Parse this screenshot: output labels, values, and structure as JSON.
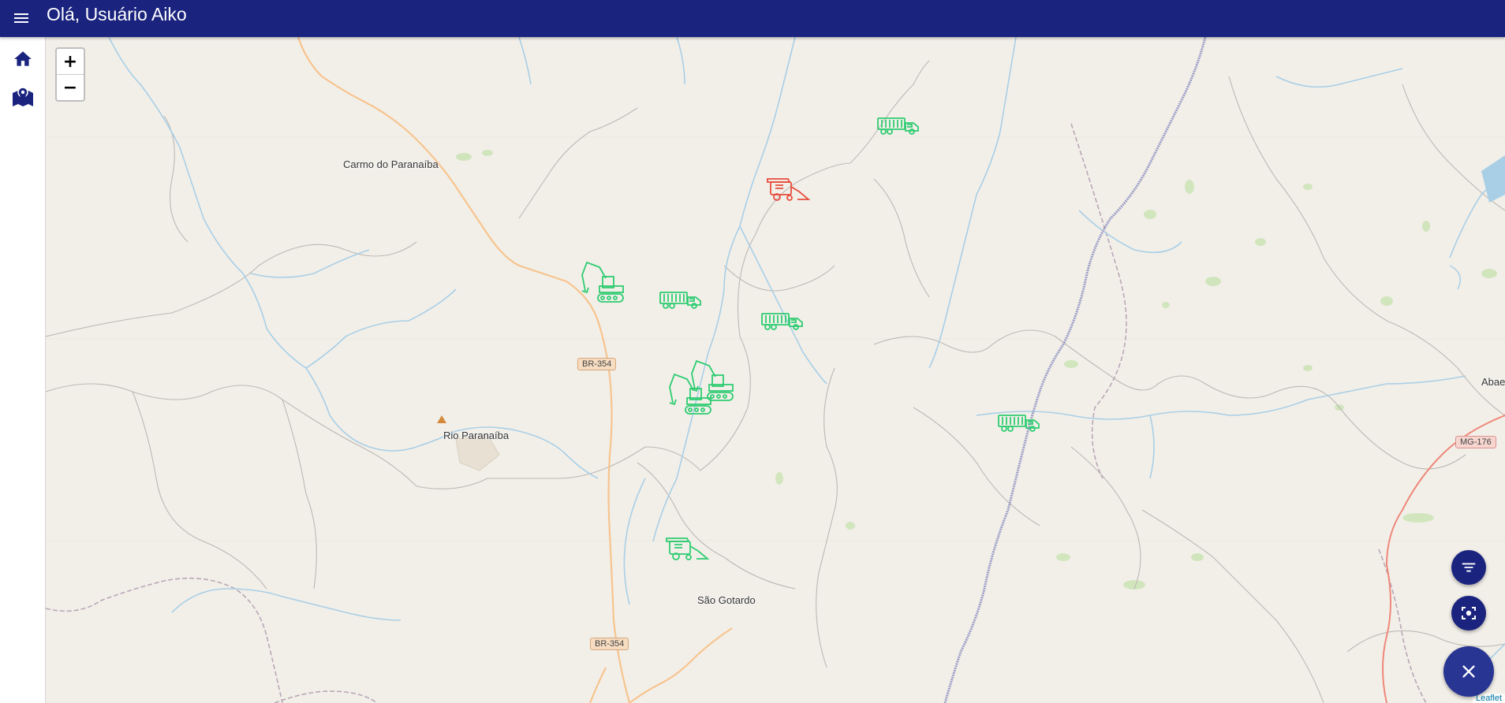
{
  "header": {
    "greeting": "Olá, Usuário Aiko",
    "menu_icon": "menu-icon"
  },
  "sidebar": {
    "items": [
      {
        "icon": "home-icon"
      },
      {
        "icon": "map-marker-icon"
      }
    ]
  },
  "map": {
    "zoom_in_label": "+",
    "zoom_out_label": "−",
    "places": [
      "Carmo do Paranaíba",
      "Rio Paranaíba",
      "São Gotardo",
      "Abae"
    ],
    "roads": [
      "BR-354",
      "BR-354",
      "MG-176"
    ],
    "attribution": "Leaflet",
    "vehicles": [
      {
        "type": "truck",
        "status": "green"
      },
      {
        "type": "harvester",
        "status": "red"
      },
      {
        "type": "excavator",
        "status": "green"
      },
      {
        "type": "truck",
        "status": "green"
      },
      {
        "type": "truck",
        "status": "green"
      },
      {
        "type": "excavator",
        "status": "green"
      },
      {
        "type": "excavator",
        "status": "green"
      },
      {
        "type": "truck",
        "status": "green"
      },
      {
        "type": "harvester",
        "status": "green"
      }
    ]
  },
  "fabs": [
    {
      "icon": "filter-icon"
    },
    {
      "icon": "center-focus-icon"
    },
    {
      "icon": "close-icon"
    }
  ],
  "colors": {
    "header": "#1a237e",
    "green": "#2ecc71",
    "red": "#e74c3c",
    "map_bg": "#f2efe9",
    "river": "#a9cfe6",
    "road_major": "#f7c48e"
  }
}
